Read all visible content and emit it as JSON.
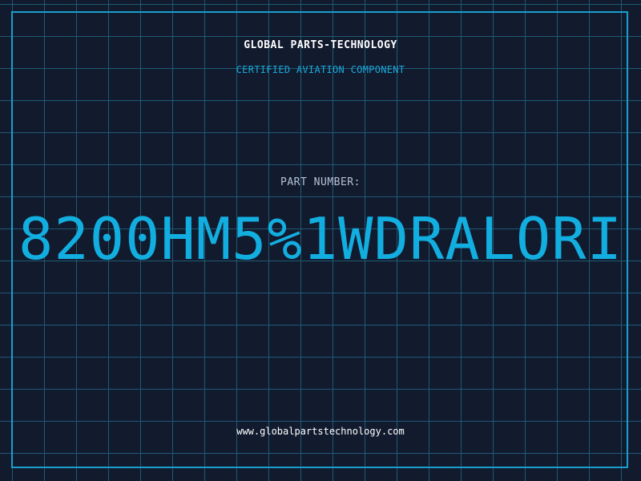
{
  "header": {
    "company": "GLOBAL PARTS-TECHNOLOGY",
    "subtitle": "CERTIFIED AVIATION COMPONENT"
  },
  "part": {
    "label": "PART NUMBER:",
    "number": "8200HM5%1WDRALORI"
  },
  "footer": {
    "url": "www.globalpartstechnology.com"
  },
  "colors": {
    "background": "#121a2e",
    "grid": "#1f5a73",
    "accent": "#12aee0",
    "frame": "#1a9ecb"
  }
}
